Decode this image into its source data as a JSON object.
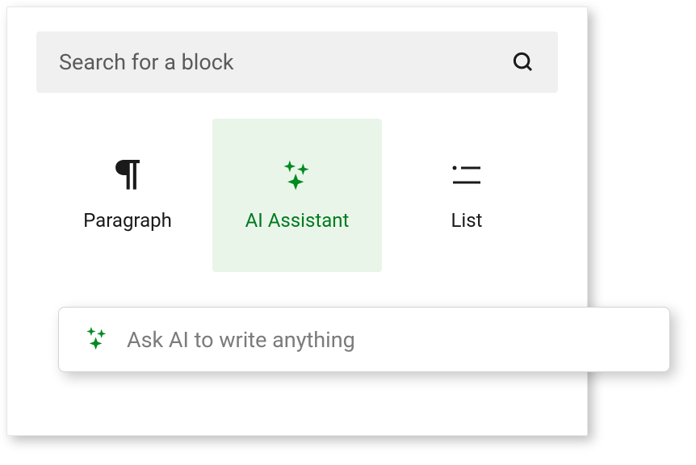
{
  "search": {
    "placeholder": "Search for a block"
  },
  "blocks": {
    "paragraph": {
      "label": "Paragraph"
    },
    "ai_assistant": {
      "label": "AI Assistant"
    },
    "list": {
      "label": "List"
    }
  },
  "ai_prompt": {
    "placeholder": "Ask AI to write anything"
  },
  "colors": {
    "accent_green": "#008a20",
    "selected_bg": "#eaf5ea"
  }
}
